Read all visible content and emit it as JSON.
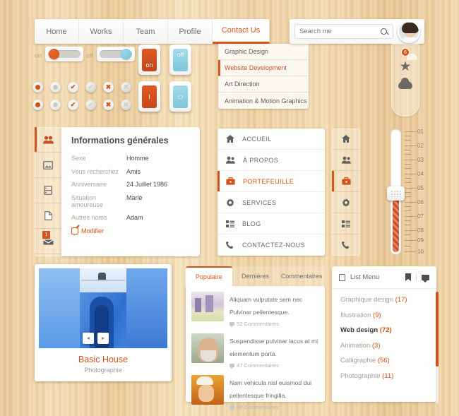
{
  "nav": {
    "tabs": [
      {
        "label": "Home",
        "active": false
      },
      {
        "label": "Works",
        "active": false
      },
      {
        "label": "Team",
        "active": false
      },
      {
        "label": "Profile",
        "active": false
      },
      {
        "label": "Contact Us",
        "active": true
      }
    ]
  },
  "dropdown": {
    "items": [
      {
        "label": "Graphic Design",
        "active": false
      },
      {
        "label": "Website Development",
        "active": true
      },
      {
        "label": "Art Direction",
        "active": false
      },
      {
        "label": "Animation & Motion Graphics",
        "active": false
      }
    ]
  },
  "search": {
    "placeholder": "Search me",
    "value": "",
    "icon": "search-icon"
  },
  "social": {
    "mail_badge": "6",
    "icons": [
      "envelope-icon",
      "star-icon",
      "cloud-icon"
    ]
  },
  "toggles": {
    "on_label": "on",
    "off_label": "off",
    "keys": [
      {
        "label": "on",
        "color": "orange"
      },
      {
        "label": "off",
        "color": "blue"
      },
      {
        "label": "I",
        "color": "orange"
      },
      {
        "label": "O",
        "color": "blue"
      }
    ]
  },
  "controls": {
    "row1": [
      "radio-on-orange",
      "radio-off-gray",
      "check-orange",
      "check-gray",
      "cross-orange",
      "cross-gray"
    ],
    "row2": [
      "radio-on-orange",
      "radio-off-gray",
      "check-orange",
      "check-gray",
      "cross-orange",
      "cross-gray"
    ],
    "check_glyph": "✔",
    "cross_glyph": "✖"
  },
  "info": {
    "title": "Informations générales",
    "icons": [
      "users-icon",
      "image-icon",
      "database-icon",
      "document-icon",
      "inbox-icon"
    ],
    "inbox_badge": "1",
    "fields": [
      {
        "key": "Sexe",
        "value": "Homme"
      },
      {
        "key": "Vous recherchez",
        "value": "Amis"
      },
      {
        "key": "Anniversaire",
        "value": "24 Juillet 1986"
      },
      {
        "key": "Situation amoureuse",
        "value": "Marié"
      },
      {
        "key": "Autres noms",
        "value": "Adam"
      }
    ],
    "edit_label": "Modifier"
  },
  "vmenu": {
    "items": [
      {
        "label": "ACCUEIL",
        "icon": "home-icon",
        "active": false
      },
      {
        "label": "À PROPOS",
        "icon": "users-icon",
        "active": false
      },
      {
        "label": "PORTEFEUILLE",
        "icon": "briefcase-icon",
        "active": true
      },
      {
        "label": "SERVICES",
        "icon": "gear-icon",
        "active": false
      },
      {
        "label": "BLOG",
        "icon": "grid-icon",
        "active": false
      },
      {
        "label": "CONTACTEZ-NOUS",
        "icon": "phone-icon",
        "active": false
      }
    ]
  },
  "ruler": {
    "labels": [
      "01",
      "02",
      "03",
      "04",
      "05",
      "06",
      "07",
      "08",
      "09",
      "10"
    ],
    "value": "05"
  },
  "photo": {
    "title": "Basic House",
    "subtitle": "Photographie",
    "prev": "◄",
    "next": "►"
  },
  "tabs": {
    "items": [
      {
        "label": "Populaire",
        "active": true
      },
      {
        "label": "Dernières",
        "active": false
      },
      {
        "label": "Commentaires",
        "active": false
      }
    ],
    "posts": [
      {
        "title": "Aliquam vulputate sem nec Pulvinar pellentesque.",
        "meta": "52 Commentaires",
        "thumb": "city-thumb"
      },
      {
        "title": "Suspendisse pulvinar lacus at mi elementum porta.",
        "meta": "47 Commentaires",
        "thumb": "portrait-thumb"
      },
      {
        "title": "Nam vehicula nisl euismod dui pellentesque fringilla.",
        "meta": "38 Commentaires",
        "thumb": "chef-thumb"
      }
    ]
  },
  "listmenu": {
    "title": "List Menu",
    "head_icons": [
      "list-icon",
      "bookmark-icon",
      "comment-icon"
    ],
    "rows": [
      {
        "label": "Graphique design",
        "count": "(17)",
        "active": false
      },
      {
        "label": "Illustration",
        "count": "(9)",
        "active": false
      },
      {
        "label": "Web design",
        "count": "(72)",
        "active": true
      },
      {
        "label": "Animation",
        "count": "(3)",
        "active": false
      },
      {
        "label": "Calligraphie",
        "count": "(56)",
        "active": false
      },
      {
        "label": "Photographie",
        "count": "(11)",
        "active": false
      }
    ]
  },
  "colors": {
    "accent": "#d4531d",
    "blue": "#7cc6dc",
    "wood": "#eccd9b"
  }
}
